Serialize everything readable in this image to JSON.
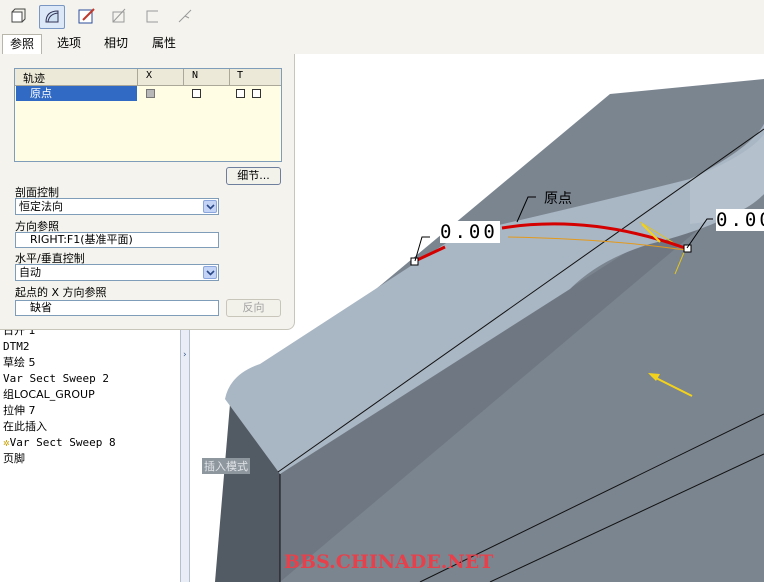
{
  "tabs": {
    "references": "参照",
    "options": "选项",
    "tangency": "相切",
    "properties": "属性"
  },
  "toolbar": {
    "icons": [
      "solid-icon",
      "surface-icon",
      "sketch-edit-icon",
      "section-icon",
      "open-section-icon",
      "line-icon"
    ]
  },
  "trajectory_table": {
    "headers": {
      "trajectory": "轨迹",
      "x": "X",
      "n": "N",
      "t": "T"
    },
    "rows": [
      {
        "name": "原点"
      }
    ]
  },
  "details_button": "细节...",
  "section_control": {
    "label": "剖面控制",
    "value": "恒定法向"
  },
  "direction_reference": {
    "label": "方向参照",
    "value": "RIGHT:F1(基准平面)"
  },
  "horizontal_vertical_control": {
    "label": "水平/垂直控制",
    "value": "自动"
  },
  "start_x_reference": {
    "label": "起点的 X 方向参照",
    "value": "缺省",
    "flip_button": "反向"
  },
  "model_tree": {
    "items": [
      "日开 1",
      "DTM2",
      "草绘 5",
      "Var Sect Sweep 2",
      "组LOCAL_GROUP",
      "拉伸 7",
      "在此插入",
      "Var Sect Sweep 8",
      "页脚"
    ]
  },
  "graphics": {
    "dim_left": "0.00",
    "dim_right": "0.00",
    "origin_label": "原点",
    "insert_mode": "插入模式",
    "watermark": "BBS.CHINADE.NET"
  },
  "colors": {
    "accent": "#316ac5",
    "trajectory": "#d40000",
    "model_top": "#a9b6c4",
    "model_side": "#7b8590",
    "watermark": "#e8404a"
  }
}
